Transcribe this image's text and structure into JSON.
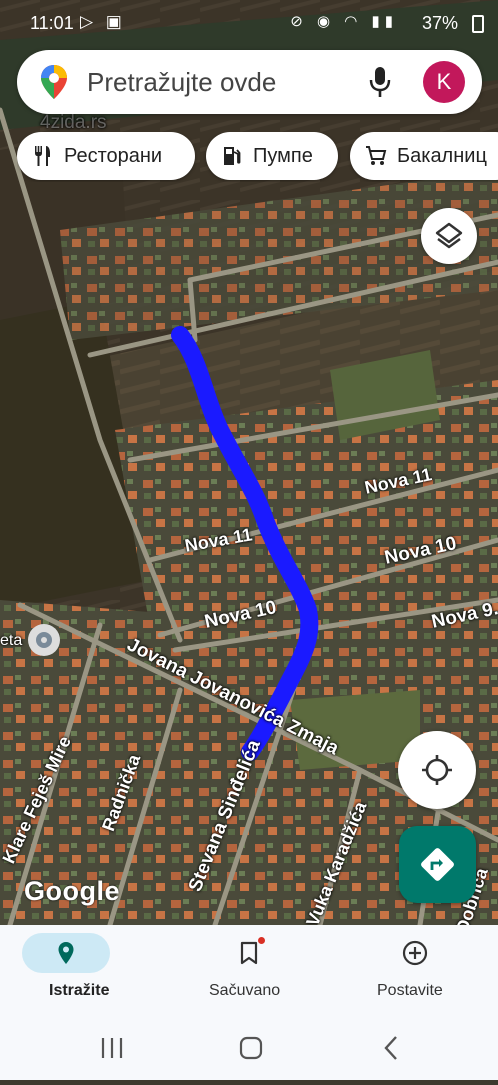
{
  "status_bar": {
    "time": "11:01",
    "battery": "37%"
  },
  "search": {
    "placeholder": "Pretražujte ovde",
    "avatar_initial": "K"
  },
  "chips": [
    {
      "label": "Ресторани",
      "icon": "fork-knife-icon"
    },
    {
      "label": "Пумпе",
      "icon": "gas-pump-icon"
    },
    {
      "label": "Бакалниц",
      "icon": "cart-icon"
    }
  ],
  "map": {
    "watermark": "4zida.rs",
    "attribution": "Google",
    "route_color": "#1a1aff",
    "place_label": "eta",
    "streets": [
      {
        "name": "Nova 11"
      },
      {
        "name": "Nova 11"
      },
      {
        "name": "Nova 10"
      },
      {
        "name": "Nova 10"
      },
      {
        "name": "Nova 9."
      },
      {
        "name": "Jovana Jovanovića Zmaja"
      },
      {
        "name": "Stevana Sinđelića"
      },
      {
        "name": "Radnička"
      },
      {
        "name": "Klare Feješ Mire"
      },
      {
        "name": "Vuka Karadžića"
      },
      {
        "name": "Dobrica"
      }
    ]
  },
  "bottom_nav": {
    "tabs": [
      {
        "label": "Istražite",
        "icon": "location-pin-icon",
        "active": true
      },
      {
        "label": "Sačuvano",
        "icon": "bookmark-icon",
        "active": false
      },
      {
        "label": "Postavite",
        "icon": "add-circle-icon",
        "active": false
      }
    ]
  },
  "colors": {
    "accent": "#00796b",
    "avatar": "#c2185b",
    "active_pill": "#cde9f5"
  }
}
